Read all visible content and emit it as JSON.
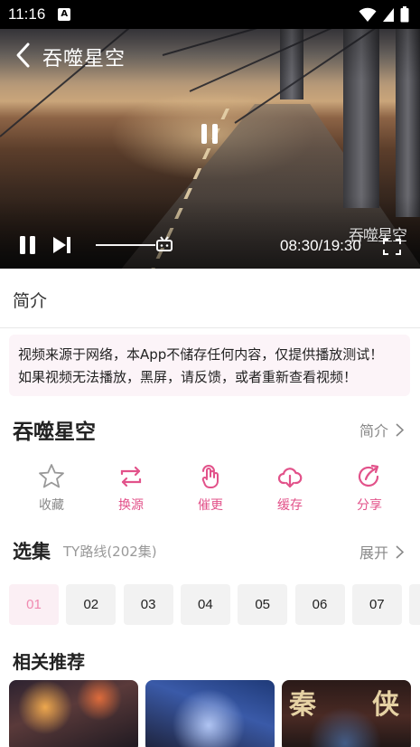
{
  "status_bar": {
    "time": "11:16",
    "notification_icon_letter": "A"
  },
  "player": {
    "title": "吞噬星空",
    "watermark": "吞噬星空",
    "time_display": "08:30/19:30",
    "progress": 0.436,
    "icons": [
      "chevron-left-icon",
      "pause-icon",
      "next-icon",
      "tv-icon",
      "fullscreen-icon"
    ]
  },
  "intro_section": {
    "heading": "简介",
    "notice_line1": "视频来源于网络，本App不储存任何内容，仅提供播放测试！",
    "notice_line2": "如果视频无法播放，黑屏，请反馈，或者重新查看视频！"
  },
  "show": {
    "title": "吞噬星空",
    "intro_link": "简介"
  },
  "actions": [
    {
      "label": "收藏",
      "icon": "star-icon"
    },
    {
      "label": "换源",
      "icon": "switch-source-icon"
    },
    {
      "label": "催更",
      "icon": "urge-update-icon"
    },
    {
      "label": "缓存",
      "icon": "cloud-download-icon"
    },
    {
      "label": "分享",
      "icon": "share-icon"
    }
  ],
  "episodes": {
    "title": "选集",
    "line": "TY路线(202集)",
    "expand": "展开",
    "items": [
      "01",
      "02",
      "03",
      "04",
      "05",
      "06",
      "07"
    ],
    "active_index": 0
  },
  "recommendations": {
    "title": "相关推荐",
    "card3_chars": [
      "秦",
      "侠"
    ]
  },
  "colors": {
    "accent": "#e2528a",
    "active_episode_text": "#f08ab0",
    "notice_bg": "#fcf4f8"
  }
}
